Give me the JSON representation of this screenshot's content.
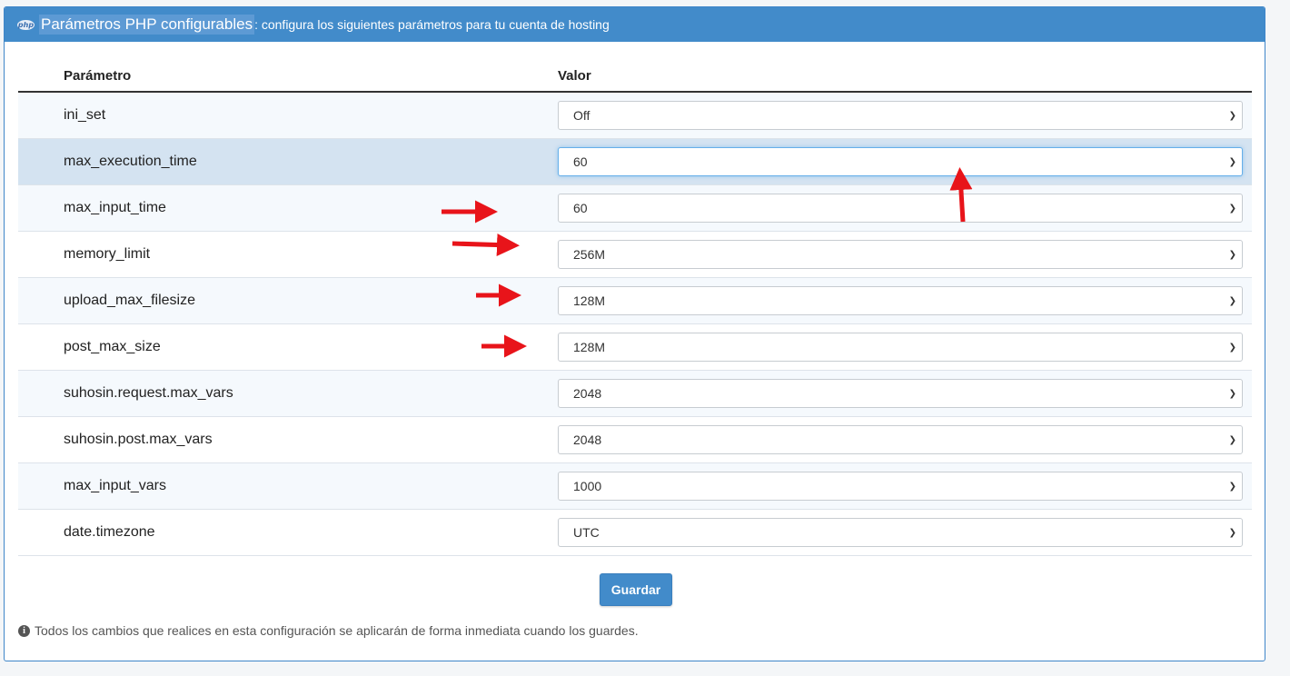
{
  "header": {
    "icon": "php-icon",
    "title": "Parámetros PHP configurables",
    "subtitle": ": configura los siguientes parámetros para tu cuenta de hosting"
  },
  "table": {
    "col_param": "Parámetro",
    "col_value": "Valor",
    "rows": [
      {
        "name": "ini_set",
        "value": "Off"
      },
      {
        "name": "max_execution_time",
        "value": "60"
      },
      {
        "name": "max_input_time",
        "value": "60"
      },
      {
        "name": "memory_limit",
        "value": "256M"
      },
      {
        "name": "upload_max_filesize",
        "value": "128M"
      },
      {
        "name": "post_max_size",
        "value": "128M"
      },
      {
        "name": "suhosin.request.max_vars",
        "value": "2048"
      },
      {
        "name": "suhosin.post.max_vars",
        "value": "2048"
      },
      {
        "name": "max_input_vars",
        "value": "1000"
      },
      {
        "name": "date.timezone",
        "value": "UTC"
      }
    ]
  },
  "actions": {
    "save_label": "Guardar"
  },
  "footer": {
    "note": "Todos los cambios que realices en esta configuración se aplicarán de forma inmediata cuando los guardes."
  },
  "colors": {
    "accent": "#428bca",
    "annotation": "#e8141a"
  }
}
